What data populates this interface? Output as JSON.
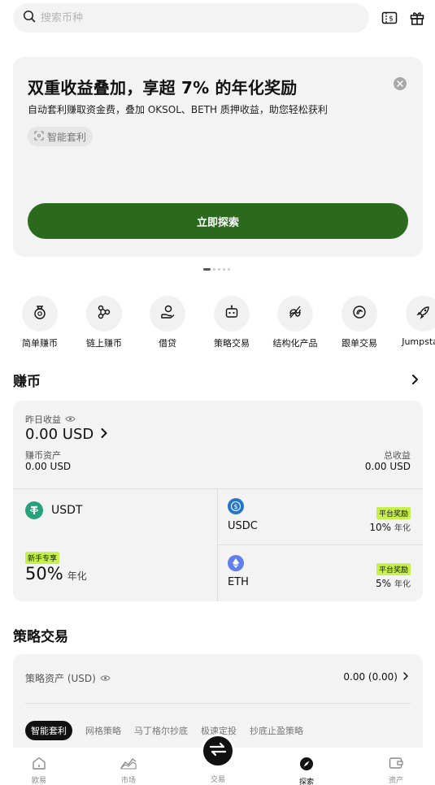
{
  "search": {
    "placeholder": "搜索币种"
  },
  "banner": {
    "title": "双重收益叠加，享超 7% 的年化奖励",
    "subtitle": "自动套利赚取资金费，叠加 OKSOL、BETH 质押收益，助您轻松获利",
    "tag": "智能套利",
    "cta": "立即探索",
    "pages": 5,
    "active_page": 1
  },
  "shortcuts": [
    {
      "label": "简单赚币",
      "icon": "coin-bag-icon"
    },
    {
      "label": "链上赚币",
      "icon": "chain-nodes-icon"
    },
    {
      "label": "借贷",
      "icon": "loan-hand-icon"
    },
    {
      "label": "策略交易",
      "icon": "robot-icon"
    },
    {
      "label": "结构化产品",
      "icon": "structured-icon"
    },
    {
      "label": "跟单交易",
      "icon": "copy-trade-icon"
    },
    {
      "label": "Jumpstart",
      "icon": "rocket-icon"
    }
  ],
  "earn": {
    "title": "赚币",
    "yesterday_label": "昨日收益",
    "yesterday_value": "0.00 USD",
    "asset_label": "赚币资产",
    "asset_value": "0.00 USD",
    "total_label": "总收益",
    "total_value": "0.00 USD",
    "usdt": {
      "name": "USDT",
      "badge": "新手专享",
      "rate": "50%",
      "unit": "年化"
    },
    "usdc": {
      "name": "USDC",
      "badge": "平台奖励",
      "rate": "10%",
      "unit": "年化"
    },
    "eth": {
      "name": "ETH",
      "badge": "平台奖励",
      "rate": "5%",
      "unit": "年化"
    }
  },
  "strategy": {
    "title": "策略交易",
    "asset_label": "策略资产 (USD)",
    "asset_value": "0.00 (0.00)",
    "tabs": [
      "智能套利",
      "网格策略",
      "马丁格尔抄底",
      "极速定投",
      "抄底止盈策略"
    ]
  },
  "nav": {
    "items": [
      "欧易",
      "市场",
      "交易",
      "探索",
      "资产"
    ],
    "active": "探索"
  },
  "colors": {
    "cta_green": "#2b6a1c",
    "badge_lime": "#c6f04b",
    "usdt": "#26a17b",
    "usdc": "#2775ca",
    "eth": "#627eea"
  }
}
